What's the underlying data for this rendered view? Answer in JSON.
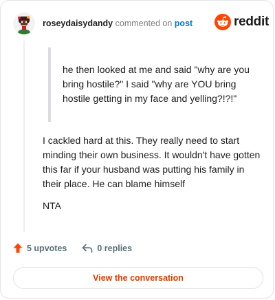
{
  "comment": {
    "author": "roseydaisydandy",
    "action_text": "commented on",
    "post_link_text": "post",
    "quote": "he then looked at me and said \"why are you bring hostile?\" I said \"why are YOU bring hostile getting in my face and yelling?!?!\"",
    "body": "I cackled hard at this. They really need to start minding their own business. It wouldn't have gotten this far if your husband was putting his family in their place. He can blame himself",
    "verdict": "NTA"
  },
  "brand": {
    "name": "reddit",
    "color": "#ff4500"
  },
  "stats": {
    "upvotes_label": "5 upvotes",
    "replies_label": "0 replies"
  },
  "actions": {
    "view_conversation_label": "View the conversation"
  },
  "colors": {
    "accent": "#d93a00",
    "link": "#0079d3",
    "muted": "#576f76",
    "upvote": "#ff4500"
  },
  "icons": {
    "avatar": "avatar",
    "logo": "reddit-snoo-icon",
    "upvote": "upvote-arrow-icon",
    "reply": "reply-arrow-icon"
  }
}
